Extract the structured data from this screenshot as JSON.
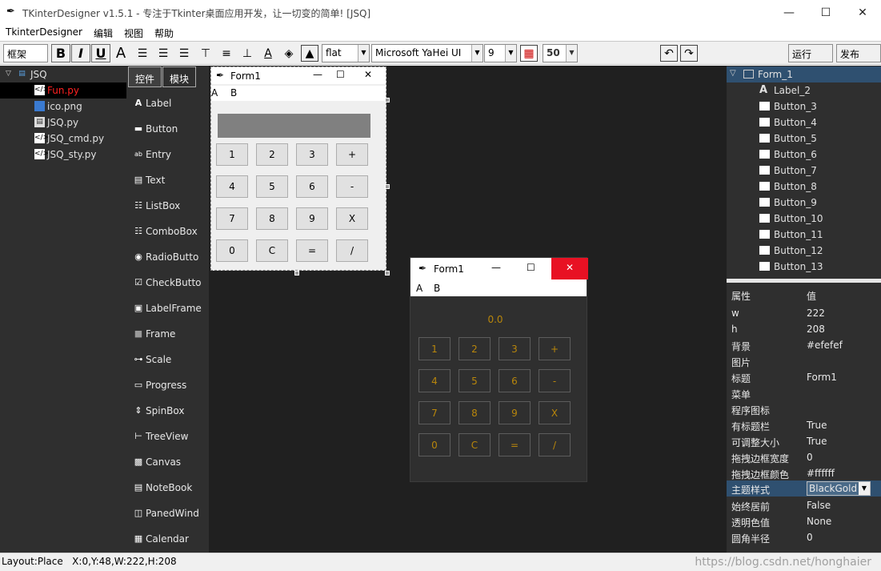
{
  "window": {
    "title": "TKinterDesigner v1.5.1 - 专注于Tkinter桌面应用开发，让一切变的简单!    [JSQ]",
    "minimize": "—",
    "maximize": "☐",
    "close": "✕"
  },
  "menubar": [
    "TkinterDesigner",
    "编辑",
    "视图",
    "帮助"
  ],
  "toolbar": {
    "frame_select": "框架",
    "bold": "B",
    "italic": "I",
    "underline": "U",
    "relief": "flat",
    "font_family": "Microsoft YaHei UI",
    "font_size": "9",
    "opacity": "50",
    "run": "运行",
    "publish": "发布"
  },
  "file_tree": {
    "root": "JSQ",
    "files": [
      {
        "name": "Fun.py",
        "selected": true
      },
      {
        "name": "ico.png",
        "selected": false
      },
      {
        "name": "JSQ.py",
        "selected": false
      },
      {
        "name": "JSQ_cmd.py",
        "selected": false
      },
      {
        "name": "JSQ_sty.py",
        "selected": false
      }
    ]
  },
  "tools_tabs": [
    "控件",
    "模块"
  ],
  "tools": [
    "Label",
    "Button",
    "Entry",
    "Text",
    "ListBox",
    "ComboBox",
    "RadioButto",
    "CheckButto",
    "LabelFrame",
    "Frame",
    "Scale",
    "Progress",
    "SpinBox",
    "TreeView",
    "Canvas",
    "NoteBook",
    "PanedWind",
    "Calendar"
  ],
  "form_editor": {
    "title": "Form1",
    "menu": [
      "A",
      "B"
    ],
    "buttons": [
      [
        "1",
        "2",
        "3",
        "+"
      ],
      [
        "4",
        "5",
        "6",
        "-"
      ],
      [
        "7",
        "8",
        "9",
        "X"
      ],
      [
        "0",
        "C",
        "=",
        "/"
      ]
    ]
  },
  "form_preview": {
    "title": "Form1",
    "menu": [
      "A",
      "B"
    ],
    "display": "0.0",
    "buttons": [
      [
        "1",
        "2",
        "3",
        "+"
      ],
      [
        "4",
        "5",
        "6",
        "-"
      ],
      [
        "7",
        "8",
        "9",
        "X"
      ],
      [
        "0",
        "C",
        "=",
        "/"
      ]
    ],
    "accent": "#b8860b",
    "close_color": "#e81123"
  },
  "component_tree": {
    "root": "Form_1",
    "items": [
      "Label_2",
      "Button_3",
      "Button_4",
      "Button_5",
      "Button_6",
      "Button_7",
      "Button_8",
      "Button_9",
      "Button_10",
      "Button_11",
      "Button_12",
      "Button_13"
    ]
  },
  "properties": {
    "header_key": "属性",
    "header_value": "值",
    "rows": [
      {
        "k": "w",
        "v": "222"
      },
      {
        "k": "h",
        "v": "208"
      },
      {
        "k": "背景",
        "v": "#efefef"
      },
      {
        "k": "图片",
        "v": ""
      },
      {
        "k": "标题",
        "v": "Form1"
      },
      {
        "k": "菜单",
        "v": ""
      },
      {
        "k": "程序图标",
        "v": ""
      },
      {
        "k": "有标题栏",
        "v": "True"
      },
      {
        "k": "可调整大小",
        "v": "True"
      },
      {
        "k": "拖拽边框宽度",
        "v": "0"
      },
      {
        "k": "拖拽边框颜色",
        "v": "#ffffff"
      },
      {
        "k": "主题样式",
        "v": "BlackGold"
      },
      {
        "k": "始终居前",
        "v": "False"
      },
      {
        "k": "透明色值",
        "v": "None"
      },
      {
        "k": "圆角半径",
        "v": "0"
      }
    ]
  },
  "status": "Layout:Place   X:0,Y:48,W:222,H:208",
  "watermark": "https://blog.csdn.net/honghaier"
}
